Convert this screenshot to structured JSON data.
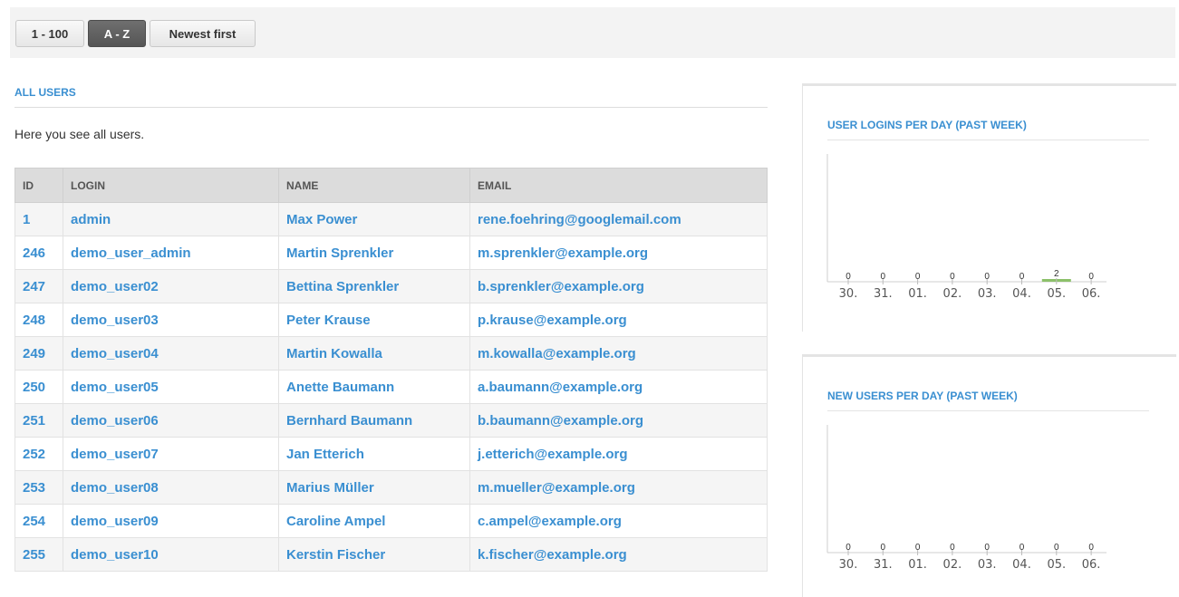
{
  "toolbar": {
    "buttons": [
      {
        "label": "1 - 100",
        "active": false
      },
      {
        "label": "A - Z",
        "active": true
      },
      {
        "label": "Newest first",
        "active": false
      }
    ]
  },
  "users_section": {
    "title": "ALL USERS",
    "description": "Here you see all users.",
    "columns": [
      "ID",
      "LOGIN",
      "NAME",
      "EMAIL"
    ],
    "rows": [
      [
        "1",
        "admin",
        "Max Power",
        "rene.foehring@googlemail.com"
      ],
      [
        "246",
        "demo_user_admin",
        "Martin Sprenkler",
        "m.sprenkler@example.org"
      ],
      [
        "247",
        "demo_user02",
        "Bettina Sprenkler",
        "b.sprenkler@example.org"
      ],
      [
        "248",
        "demo_user03",
        "Peter Krause",
        "p.krause@example.org"
      ],
      [
        "249",
        "demo_user04",
        "Martin Kowalla",
        "m.kowalla@example.org"
      ],
      [
        "250",
        "demo_user05",
        "Anette Baumann",
        "a.baumann@example.org"
      ],
      [
        "251",
        "demo_user06",
        "Bernhard Baumann",
        "b.baumann@example.org"
      ],
      [
        "252",
        "demo_user07",
        "Jan Etterich",
        "j.etterich@example.org"
      ],
      [
        "253",
        "demo_user08",
        "Marius Müller",
        "m.mueller@example.org"
      ],
      [
        "254",
        "demo_user09",
        "Caroline Ampel",
        "c.ampel@example.org"
      ],
      [
        "255",
        "demo_user10",
        "Kerstin Fischer",
        "k.fischer@example.org"
      ]
    ]
  },
  "chart_data": [
    {
      "type": "bar",
      "title": "USER LOGINS PER DAY (PAST WEEK)",
      "categories": [
        "30.",
        "31.",
        "01.",
        "02.",
        "03.",
        "04.",
        "05.",
        "06."
      ],
      "values": [
        0,
        0,
        0,
        0,
        0,
        0,
        2,
        0
      ],
      "xlabel": "",
      "ylabel": "",
      "bar_color": "#8cc06a"
    },
    {
      "type": "bar",
      "title": "NEW USERS PER DAY (PAST WEEK)",
      "categories": [
        "30.",
        "31.",
        "01.",
        "02.",
        "03.",
        "04.",
        "05.",
        "06."
      ],
      "values": [
        0,
        0,
        0,
        0,
        0,
        0,
        0,
        0
      ],
      "xlabel": "",
      "ylabel": "",
      "bar_color": "#8cc06a"
    }
  ],
  "colors": {
    "link": "#3a8fd1",
    "active_button": "#555555"
  }
}
